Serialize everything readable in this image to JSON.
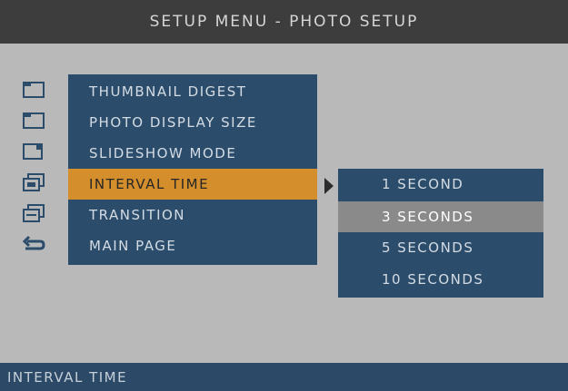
{
  "header": {
    "title": "SETUP MENU - PHOTO SETUP"
  },
  "menu": {
    "items": [
      {
        "label": "THUMBNAIL DIGEST",
        "icon": "thumbnail-icon"
      },
      {
        "label": "PHOTO DISPLAY SIZE",
        "icon": "display-size-icon"
      },
      {
        "label": "SLIDESHOW MODE",
        "icon": "slideshow-icon"
      },
      {
        "label": "INTERVAL TIME",
        "icon": "interval-icon",
        "selected": true
      },
      {
        "label": "TRANSITION",
        "icon": "transition-icon"
      },
      {
        "label": "MAIN PAGE",
        "icon": "return-icon"
      }
    ]
  },
  "submenu": {
    "options": [
      "1 SECOND",
      "3 SECONDS",
      "5 SECONDS",
      "10 SECONDS"
    ],
    "selected": "3 SECONDS"
  },
  "status": {
    "text": "INTERVAL TIME"
  },
  "colors": {
    "background": "#b9b9b9",
    "title_bar": "#3d3d3d",
    "panel": "#2b4d6b",
    "selected_item": "#d48f2c",
    "selected_option": "#8a8a8a",
    "status_bar": "#2c4a67"
  }
}
